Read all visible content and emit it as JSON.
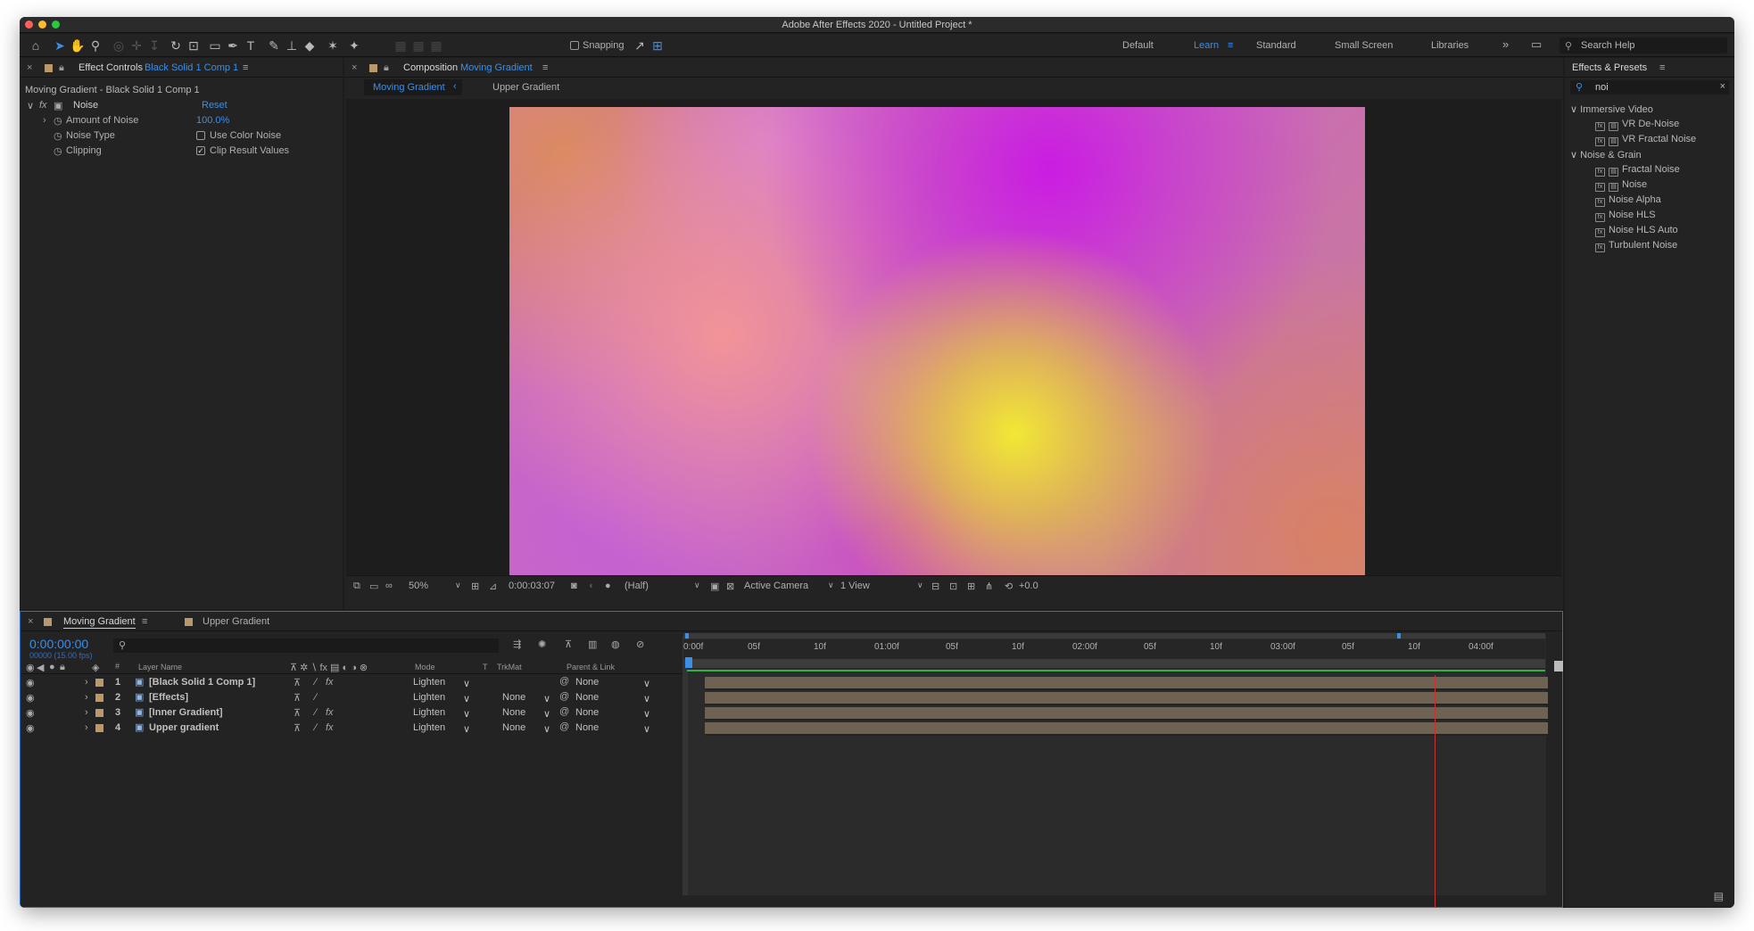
{
  "window": {
    "title": "Adobe After Effects 2020 - Untitled Project *"
  },
  "toolbar": {
    "snapping_label": "Snapping",
    "workspaces": [
      "Default",
      "Learn",
      "Standard",
      "Small Screen",
      "Libraries"
    ],
    "active_workspace": "Learn",
    "search_help_placeholder": "Search Help"
  },
  "effect_controls": {
    "tab_label": "Effect Controls",
    "tab_layer": "Black Solid 1 Comp 1",
    "subtitle": "Moving Gradient - Black Solid 1 Comp 1",
    "effect_name": "Noise",
    "reset_label": "Reset",
    "props": [
      {
        "name": "Amount of Noise",
        "value": "100.0%"
      },
      {
        "name": "Noise Type",
        "value": "Use Color Noise",
        "checked": false
      },
      {
        "name": "Clipping",
        "value": "Clip Result Values",
        "checked": true
      }
    ]
  },
  "composition": {
    "tab_label": "Composition",
    "tab_name": "Moving Gradient",
    "breadcrumbs": [
      "Moving Gradient",
      "Upper Gradient"
    ],
    "viewer_bar": {
      "zoom": "50%",
      "timecode": "0:00:03:07",
      "resolution": "(Half)",
      "camera": "Active Camera",
      "views": "1 View",
      "exposure": "+0.0"
    }
  },
  "effects_presets": {
    "title": "Effects & Presets",
    "search_value": "noi",
    "groups": [
      {
        "name": "Immersive Video",
        "items": [
          "VR De-Noise",
          "VR Fractal Noise"
        ]
      },
      {
        "name": "Noise & Grain",
        "items": [
          "Fractal Noise",
          "Noise",
          "Noise Alpha",
          "Noise HLS",
          "Noise HLS Auto",
          "Turbulent Noise"
        ]
      }
    ]
  },
  "timeline": {
    "tabs": [
      "Moving Gradient",
      "Upper Gradient"
    ],
    "timecode": "0:00:00:00",
    "frame_info": "00000 (15.00 fps)",
    "columns": {
      "num": "#",
      "layer_name": "Layer Name",
      "mode": "Mode",
      "t": "T",
      "trkmat": "TrkMat",
      "parent": "Parent & Link"
    },
    "layers": [
      {
        "num": "1",
        "name": "[Black Solid 1 Comp 1]",
        "mode": "Lighten",
        "trkmat": "",
        "parent": "None"
      },
      {
        "num": "2",
        "name": "[Effects]",
        "mode": "Lighten",
        "trkmat": "None",
        "parent": "None"
      },
      {
        "num": "3",
        "name": "[Inner Gradient]",
        "mode": "Lighten",
        "trkmat": "None",
        "parent": "None"
      },
      {
        "num": "4",
        "name": "Upper gradient",
        "mode": "Lighten",
        "trkmat": "None",
        "parent": "None"
      }
    ],
    "ruler": [
      "0:00f",
      "05f",
      "10f",
      "01:00f",
      "05f",
      "10f",
      "02:00f",
      "05f",
      "10f",
      "03:00f",
      "05f",
      "10f",
      "04:00f"
    ]
  },
  "colors": {
    "accent": "#3d8ee6",
    "layer_label": "#b9986a",
    "track": "#6e6253",
    "work_area": "#2fb344",
    "current_time": "#c8332f"
  }
}
